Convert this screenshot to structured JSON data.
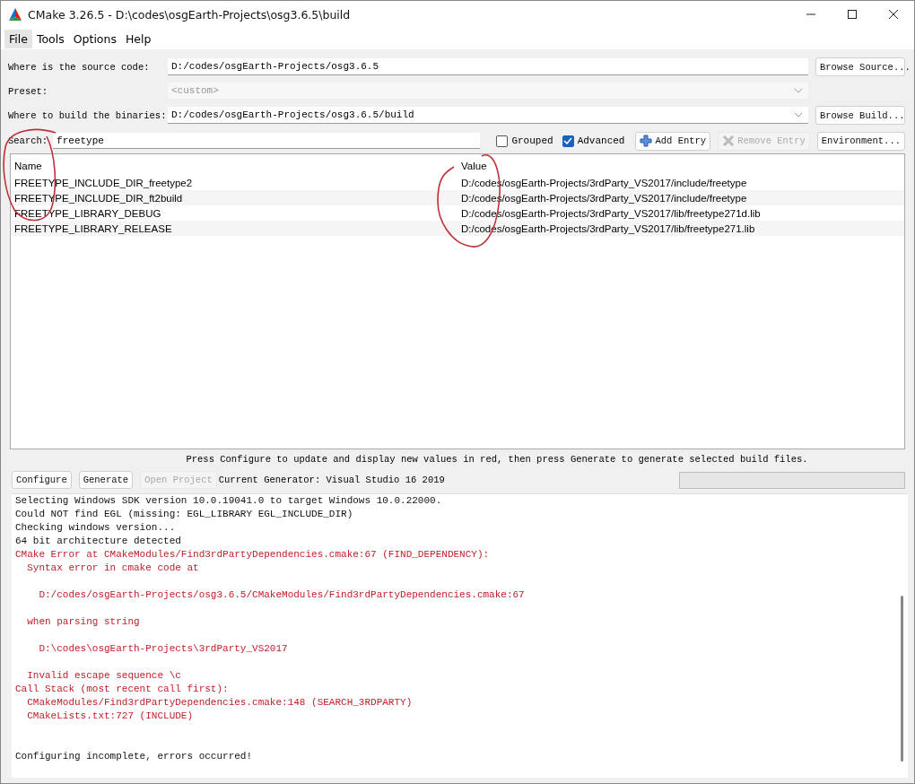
{
  "window": {
    "title": "CMake 3.26.5 - D:\\codes\\osgEarth-Projects\\osg3.6.5\\build"
  },
  "menu": [
    {
      "label": "File",
      "selected": true
    },
    {
      "label": "Tools",
      "selected": false
    },
    {
      "label": "Options",
      "selected": false
    },
    {
      "label": "Help",
      "selected": false
    }
  ],
  "paths": [
    {
      "kind": "text",
      "label": "Where is the source code:",
      "value": "D:/codes/osgEarth-Projects/osg3.6.5",
      "button": "Browse Source...",
      "disabled": false
    },
    {
      "kind": "combo",
      "label": "Preset:",
      "value": "<custom>",
      "disabled": true
    },
    {
      "kind": "combo",
      "label": "Where to build the binaries:",
      "value": "D:/codes/osgEarth-Projects/osg3.6.5/build",
      "button": "Browse Build...",
      "disabled": false
    }
  ],
  "search": {
    "label": "Search:",
    "value": "freetype"
  },
  "toggles": [
    {
      "label": "Grouped",
      "checked": false
    },
    {
      "label": "Advanced",
      "checked": true
    }
  ],
  "toolbar_buttons": [
    {
      "kind": "add",
      "label": "Add Entry",
      "disabled": false
    },
    {
      "kind": "remove",
      "label": "Remove Entry",
      "disabled": true
    },
    {
      "kind": "plain",
      "label": "Environment...",
      "disabled": false
    }
  ],
  "table": {
    "columns": [
      "Name",
      "Value"
    ],
    "rows": [
      {
        "name": "FREETYPE_INCLUDE_DIR_freetype2",
        "value": "D:/codes/osgEarth-Projects/3rdParty_VS2017/include/freetype"
      },
      {
        "name": "FREETYPE_INCLUDE_DIR_ft2build",
        "value": "D:/codes/osgEarth-Projects/3rdParty_VS2017/include/freetype"
      },
      {
        "name": "FREETYPE_LIBRARY_DEBUG",
        "value": "D:/codes/osgEarth-Projects/3rdParty_VS2017/lib/freetype271d.lib"
      },
      {
        "name": "FREETYPE_LIBRARY_RELEASE",
        "value": "D:/codes/osgEarth-Projects/3rdParty_VS2017/lib/freetype271.lib"
      }
    ]
  },
  "annotations": [
    {
      "kind": "loop"
    },
    {
      "kind": "loop"
    }
  ],
  "hint": "Press Configure to update and display new values in red, then press Generate to generate selected build files.",
  "actions": [
    {
      "label": "Configure",
      "disabled": false
    },
    {
      "label": "Generate",
      "disabled": false
    },
    {
      "label": "Open Project",
      "disabled": true
    }
  ],
  "generator": "Current Generator: Visual Studio 16 2019",
  "progress": {
    "level": 0
  },
  "log": [
    {
      "kind": "info",
      "text": "Selecting Windows SDK version 10.0.19041.0 to target Windows 10.0.22000."
    },
    {
      "kind": "info",
      "text": "Could NOT find EGL (missing: EGL_LIBRARY EGL_INCLUDE_DIR)"
    },
    {
      "kind": "info",
      "text": "Checking windows version..."
    },
    {
      "kind": "info",
      "text": "64 bit architecture detected"
    },
    {
      "kind": "error",
      "text": "CMake Error at CMakeModules/Find3rdPartyDependencies.cmake:67 (FIND_DEPENDENCY):"
    },
    {
      "kind": "error",
      "text": "  Syntax error in cmake code at"
    },
    {
      "kind": "blank"
    },
    {
      "kind": "error",
      "text": "    D:/codes/osgEarth-Projects/osg3.6.5/CMakeModules/Find3rdPartyDependencies.cmake:67"
    },
    {
      "kind": "blank"
    },
    {
      "kind": "error",
      "text": "  when parsing string"
    },
    {
      "kind": "blank"
    },
    {
      "kind": "error",
      "text": "    D:\\codes\\osgEarth-Projects\\3rdParty_VS2017"
    },
    {
      "kind": "blank"
    },
    {
      "kind": "error",
      "text": "  Invalid escape sequence \\c"
    },
    {
      "kind": "error",
      "text": "Call Stack (most recent call first):"
    },
    {
      "kind": "error",
      "text": "  CMakeModules/Find3rdPartyDependencies.cmake:148 (SEARCH_3RDPARTY)"
    },
    {
      "kind": "error",
      "text": "  CMakeLists.txt:727 (INCLUDE)"
    },
    {
      "kind": "blank"
    },
    {
      "kind": "blank"
    },
    {
      "kind": "info",
      "text": "Configuring incomplete, errors occurred!"
    }
  ]
}
